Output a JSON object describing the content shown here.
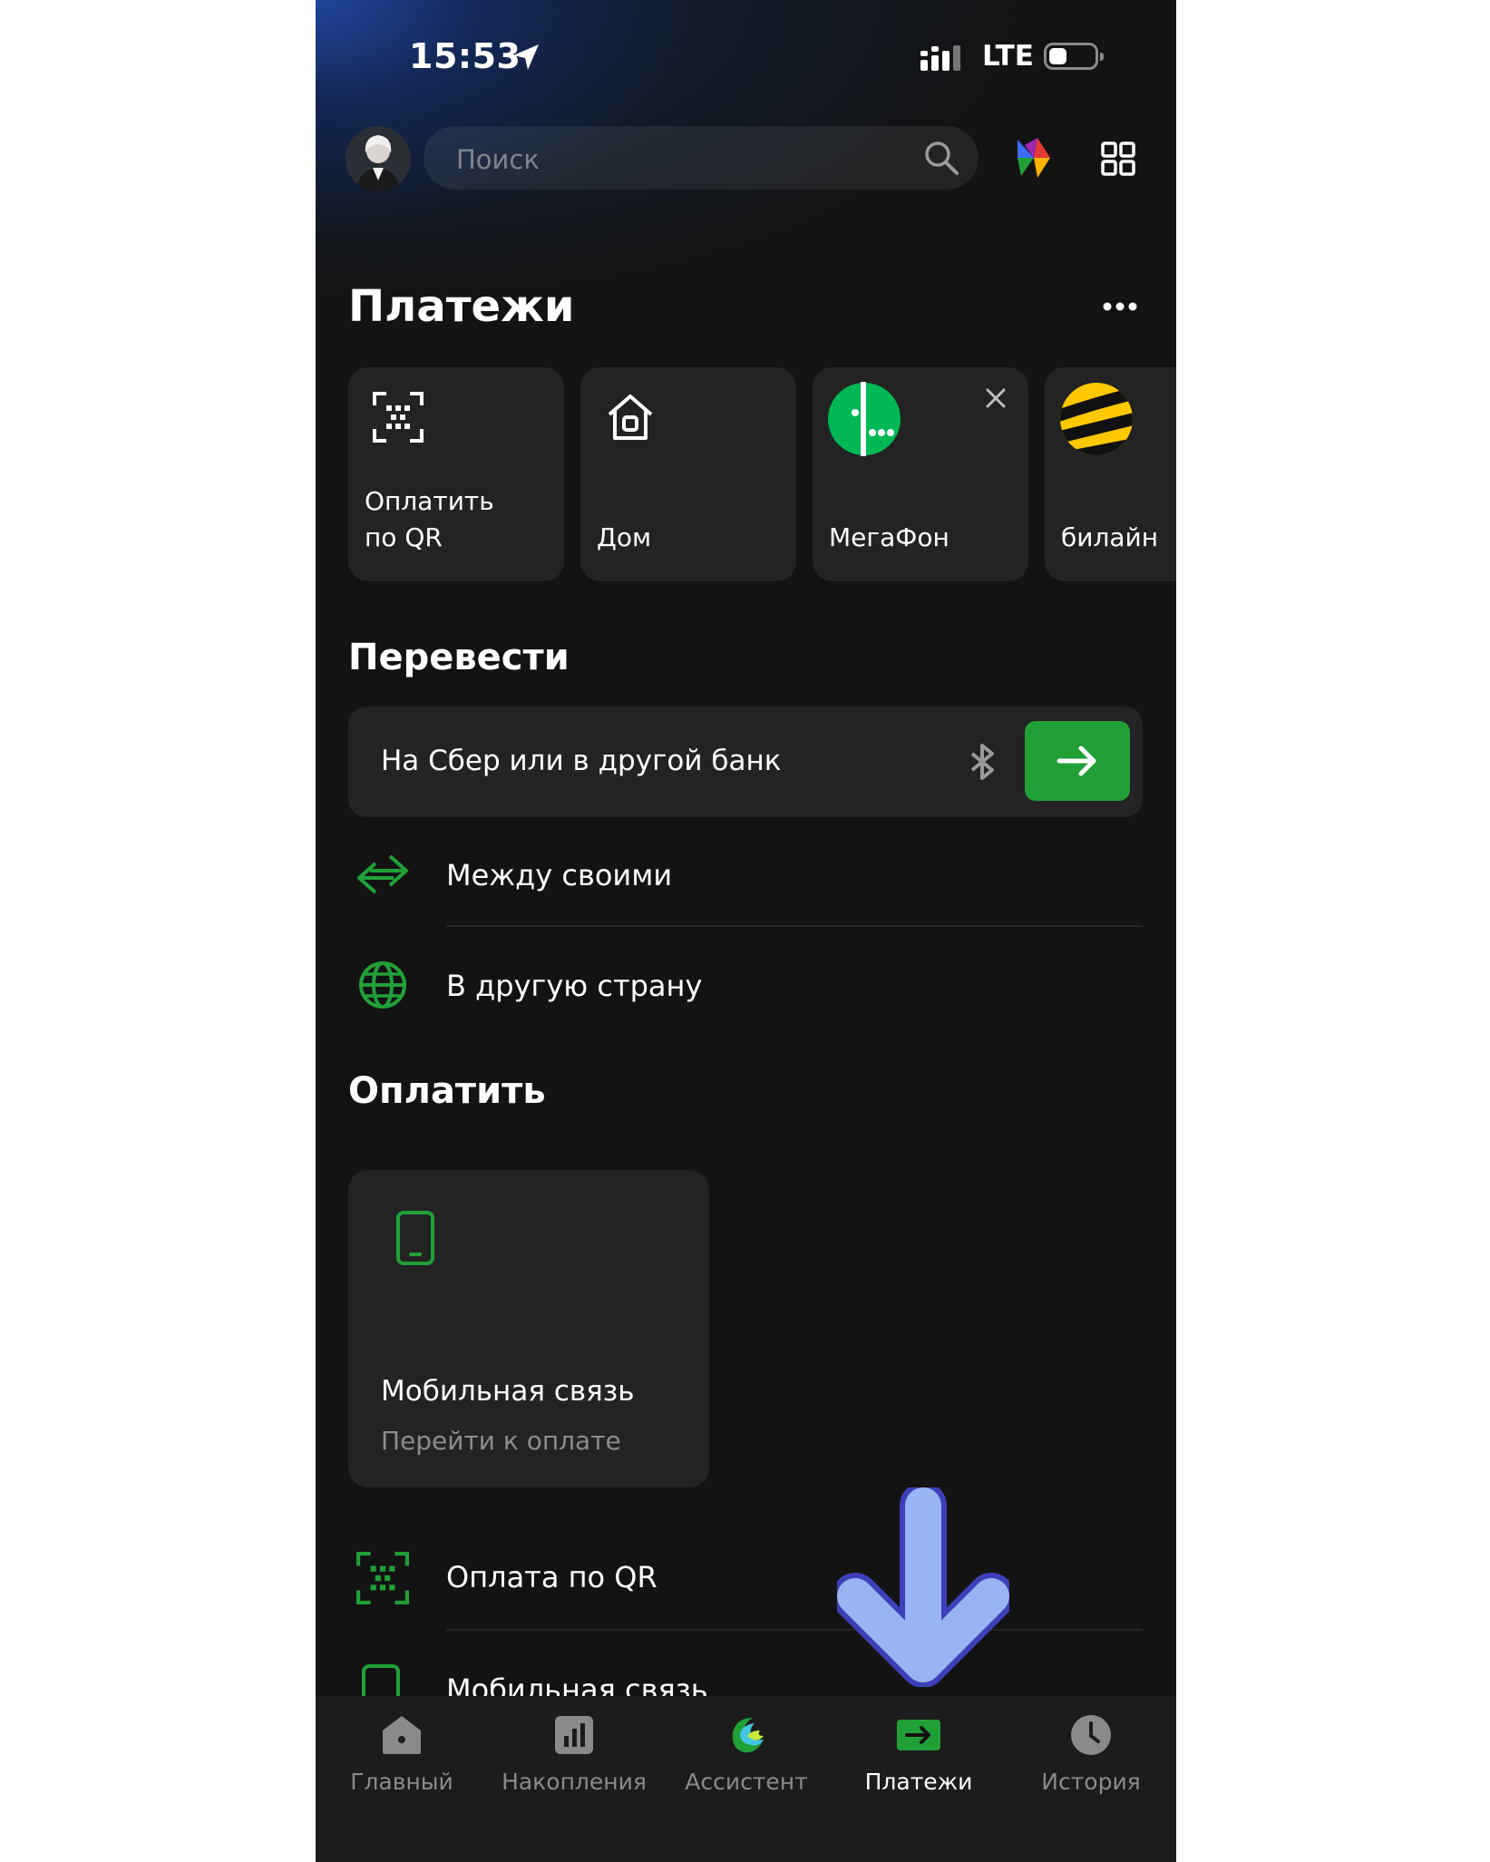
{
  "status_bar": {
    "time": "15:53",
    "network": "LTE"
  },
  "header": {
    "search_placeholder": "Поиск"
  },
  "payments": {
    "title": "Платежи",
    "tiles": [
      {
        "label_line1": "Оплатить",
        "label_line2": "по QR",
        "icon": "qr-scan-icon"
      },
      {
        "label": "Дом",
        "icon": "home-icon"
      },
      {
        "label": "МегаФон",
        "icon": "megafon-logo"
      },
      {
        "label": "билайн",
        "icon": "beeline-logo"
      }
    ]
  },
  "transfer": {
    "title": "Перевести",
    "main_field": "На Сбер или в другой банк",
    "rows": [
      {
        "label": "Между своими",
        "icon": "between-accounts-icon"
      },
      {
        "label": "В другую страну",
        "icon": "globe-icon"
      }
    ]
  },
  "pay": {
    "title": "Оплатить",
    "card": {
      "title": "Мобильная связь",
      "subtitle": "Перейти к оплате",
      "icon": "mobile-phone-icon"
    },
    "rows": [
      {
        "label": "Оплата по QR",
        "icon": "qr-scan-icon"
      },
      {
        "label": "Мобильная связь",
        "icon": "mobile-phone-icon"
      }
    ]
  },
  "tabbar": {
    "tabs": [
      {
        "label": "Главный",
        "icon": "home-icon"
      },
      {
        "label": "Накопления",
        "icon": "chart-icon"
      },
      {
        "label": "Ассистент",
        "icon": "assistant-icon"
      },
      {
        "label": "Платежи",
        "icon": "payments-icon",
        "active": true
      },
      {
        "label": "История",
        "icon": "clock-icon"
      }
    ]
  },
  "colors": {
    "accent_green": "#21a038",
    "background": "#131313",
    "tile": "#232323",
    "annotation_arrow": "#98b4f4"
  }
}
